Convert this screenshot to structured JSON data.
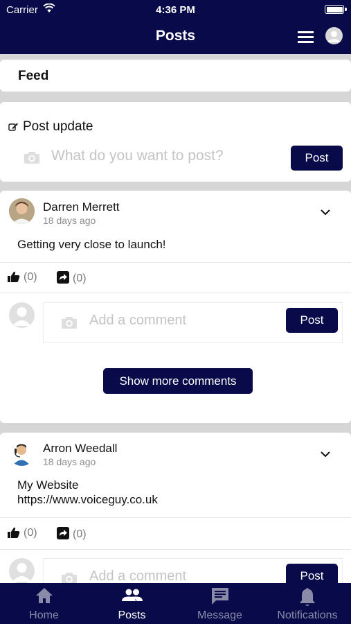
{
  "status_bar": {
    "carrier": "Carrier",
    "time": "4:36 PM"
  },
  "header": {
    "title": "Posts"
  },
  "feed": {
    "title": "Feed"
  },
  "post_update": {
    "label": "Post update",
    "placeholder": "What do you want to post?",
    "post_button": "Post"
  },
  "posts": [
    {
      "author": "Darren Merrett",
      "time_ago": "18 days ago",
      "text": "Getting very close to launch!",
      "likes": "(0)",
      "shares": "(0)",
      "comment_placeholder": "Add a comment",
      "comment_button": "Post",
      "show_more": "Show more comments"
    },
    {
      "author": "Arron Weedall",
      "time_ago": "18 days ago",
      "text_line1": "My Website",
      "text_line2": "https://www.voiceguy.co.uk",
      "likes": "(0)",
      "shares": "(0)",
      "comment_placeholder": "Add a comment",
      "comment_button": "Post"
    }
  ],
  "tabs": [
    {
      "label": "Home",
      "icon": "home-icon",
      "active": false
    },
    {
      "label": "Posts",
      "icon": "people-icon",
      "active": true
    },
    {
      "label": "Message",
      "icon": "message-icon",
      "active": false
    },
    {
      "label": "Notifications",
      "icon": "bell-icon",
      "active": false
    }
  ],
  "colors": {
    "brand": "#080a4a",
    "background": "#d6d6d6",
    "inactive_tab": "#8a8ba8"
  }
}
